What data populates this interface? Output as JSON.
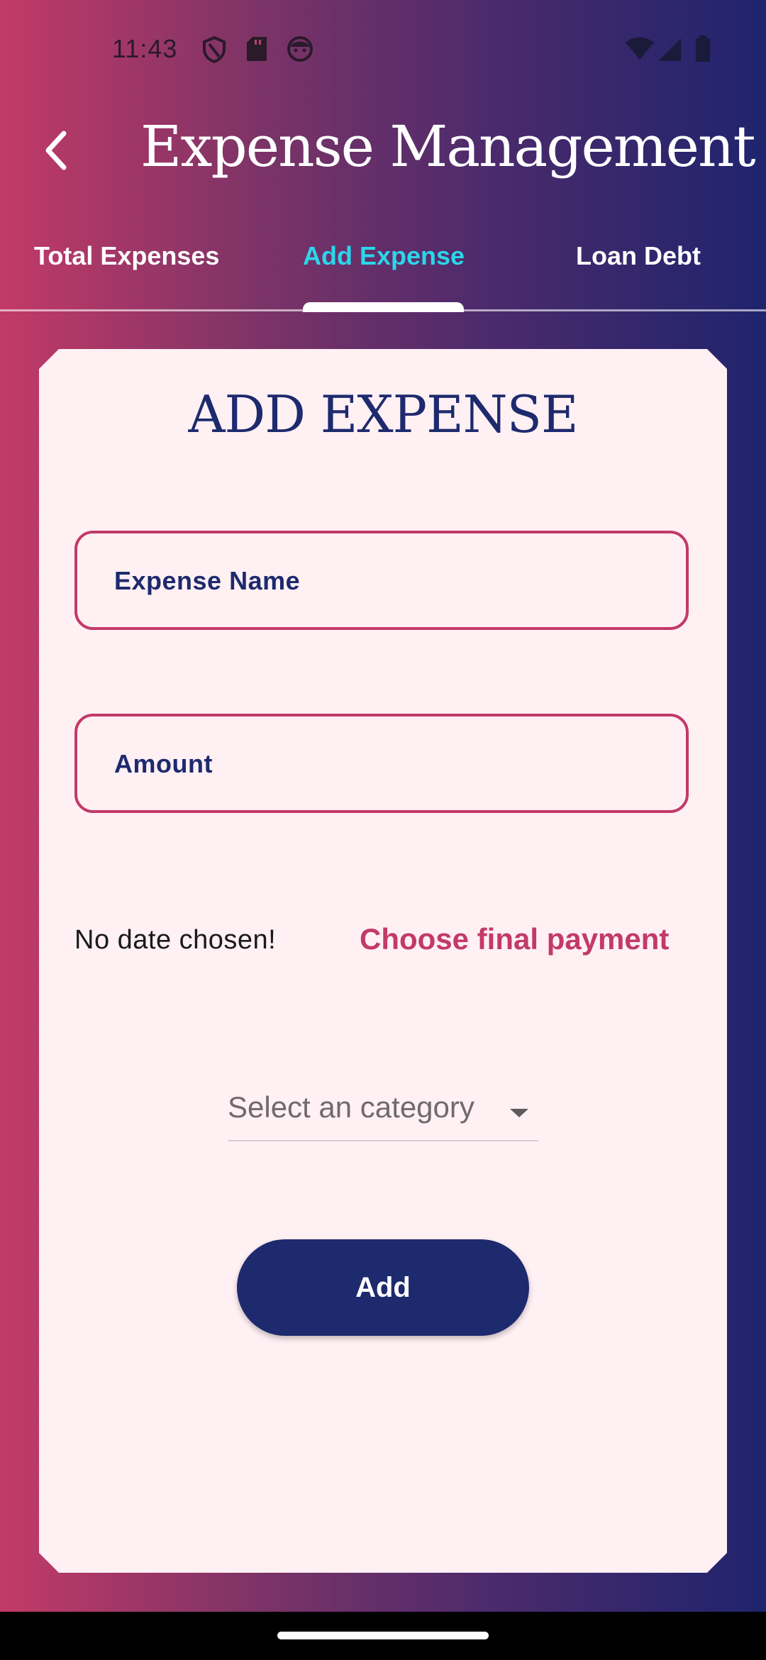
{
  "status_bar": {
    "time": "11:43",
    "icons": [
      "shield-icon",
      "sd-card-icon",
      "face-icon",
      "wifi-icon",
      "signal-icon",
      "battery-icon"
    ]
  },
  "app_bar": {
    "title": "Expense Management",
    "back_icon": "chevron-left-icon"
  },
  "tabs": [
    {
      "label": "Total Expenses",
      "active": false
    },
    {
      "label": "Add Expense",
      "active": true
    },
    {
      "label": "Loan Debt",
      "active": false
    }
  ],
  "form": {
    "title": "ADD EXPENSE",
    "expense_name_label": "Expense Name",
    "amount_label": "Amount",
    "date_text": "No date chosen!",
    "date_button": "Choose final payment",
    "category_placeholder": "Select an category",
    "submit_label": "Add"
  },
  "colors": {
    "gradient_start": "#c23a67",
    "gradient_end": "#1f246d",
    "accent_pink": "#c23a67",
    "navy": "#1e2a6e",
    "active_tab": "#2bd6ea",
    "card_bg": "#fff0f4"
  }
}
